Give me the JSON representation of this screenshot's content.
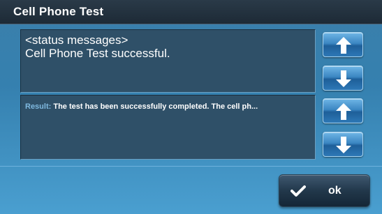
{
  "window": {
    "title": "Cell Phone Test"
  },
  "status_panel": {
    "lines": [
      "<status messages>",
      "Cell Phone Test successful."
    ]
  },
  "result_panel": {
    "label": "Result:",
    "value": "The test has been successfully completed. The cell ph..."
  },
  "icons": {
    "up": "arrow-up-icon",
    "down": "arrow-down-icon",
    "ok": "checkmark-icon"
  },
  "footer": {
    "ok_label": "ok"
  },
  "colors": {
    "titlebar": "#1d2a36",
    "panel": "#2f5068",
    "background": "#3580af",
    "button_blue": "#3b86c2",
    "result_label": "#7fb9e0"
  }
}
